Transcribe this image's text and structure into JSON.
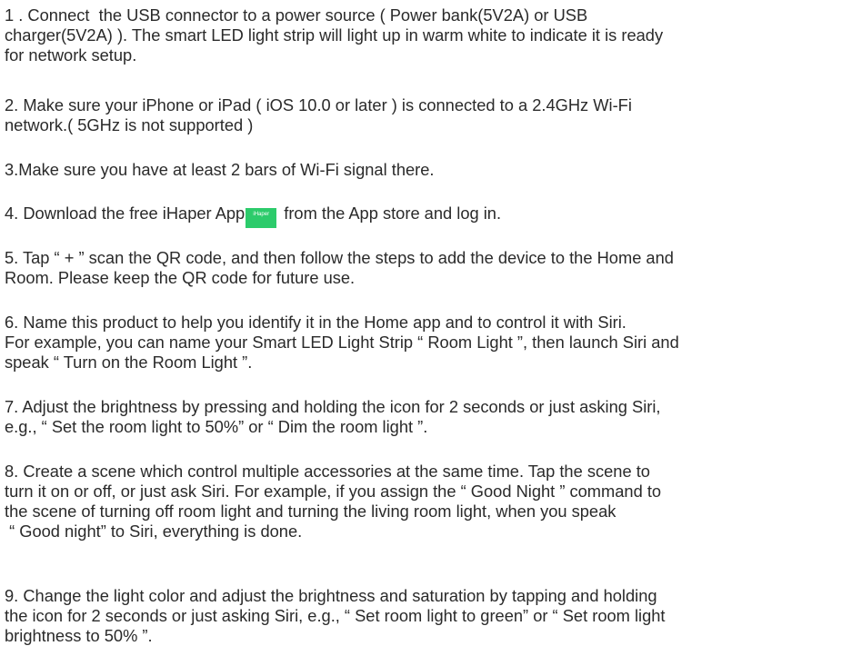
{
  "steps": [
    {
      "lines": [
        "1 . Connect  the USB connector to a power source ( Power bank(5V2A) or USB",
        "charger(5V2A) ). The smart LED light strip will light up in warm white to indicate it is ready",
        "for network setup."
      ]
    },
    {
      "lines": [
        "2. Make sure your iPhone or iPad ( iOS 10.0 or later ) is connected to a 2.4GHz Wi-Fi",
        "network.( 5GHz is not supported )"
      ]
    },
    {
      "lines": [
        "3.Make sure you have at least 2 bars of Wi-Fi signal there."
      ]
    },
    {
      "before_icon": "4. Download the free iHaper App",
      "after_icon": "from the App store and log in.",
      "app_icon_label": "iHaper",
      "app_icon_color": "#2ccb6b"
    },
    {
      "lines": [
        "5. Tap “ + ” scan the QR code, and then follow the steps to add the device to the Home and",
        "Room. Please keep the QR code for future use."
      ]
    },
    {
      "lines": [
        "6. Name this product to help you identify it in the Home app and to control it with Siri.",
        "For example, you can name your Smart LED Light Strip “ Room Light ”, then launch Siri and",
        "speak “ Turn on the Room Light ”."
      ]
    },
    {
      "lines": [
        "7. Adjust the brightness by pressing and holding the icon for 2 seconds or just asking Siri,",
        "e.g., “ Set the room light to 50%” or “ Dim the room light ”."
      ]
    },
    {
      "lines": [
        "8. Create a scene which control multiple accessories at the same time. Tap the scene to",
        "turn it on or off, or just ask Siri. For example, if you assign the “ Good Night ” command to",
        "the scene of turning off room light and turning the living room light, when you speak",
        " “ Good night” to Siri, everything is done."
      ]
    },
    {
      "lines": [
        "9. Change the light color and adjust the brightness and saturation by tapping and holding",
        "the icon for 2 seconds or just asking Siri, e.g., “ Set room light to green” or “ Set room light",
        "brightness to 50% ”."
      ]
    }
  ]
}
